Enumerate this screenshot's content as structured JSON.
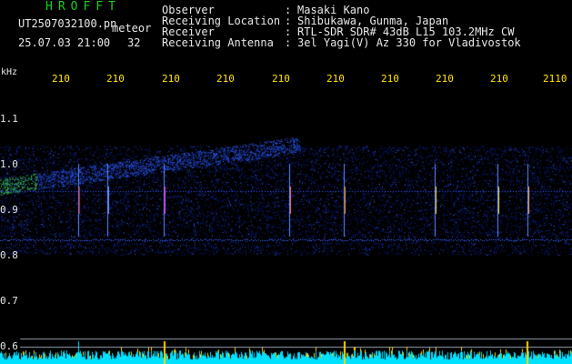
{
  "header": {
    "brand": "HROFFT",
    "filename": "UT2507032100.pn",
    "type": "meteor",
    "datetime": "25.07.03 21:00",
    "count": "32"
  },
  "info": [
    {
      "label": "Observer",
      "value": "Masaki Kano"
    },
    {
      "label": "Receiving Location",
      "value": "Shibukawa, Gunma, Japan"
    },
    {
      "label": "Receiver",
      "value": "RTL-SDR SDR# 43dB L15 103.2MHz CW"
    },
    {
      "label": "Receiving Antenna",
      "value": "3el Yagi(V) Az 330 for Vladivostok"
    }
  ],
  "axis": {
    "unit": "kHz",
    "x_ticks": [
      "210",
      "210",
      "210",
      "210",
      "210",
      "210",
      "210",
      "210",
      "210",
      "2110"
    ],
    "y_ticks": [
      "1.1",
      "1.0",
      "0.9",
      "0.8",
      "0.7",
      "0.6"
    ]
  },
  "colors": {
    "background": "#000000",
    "brand": "#19d019",
    "text": "#e8e8e8",
    "tick": "#ffe300",
    "noise": "#1d3fd6",
    "spectrum": "#00e0ff"
  }
}
